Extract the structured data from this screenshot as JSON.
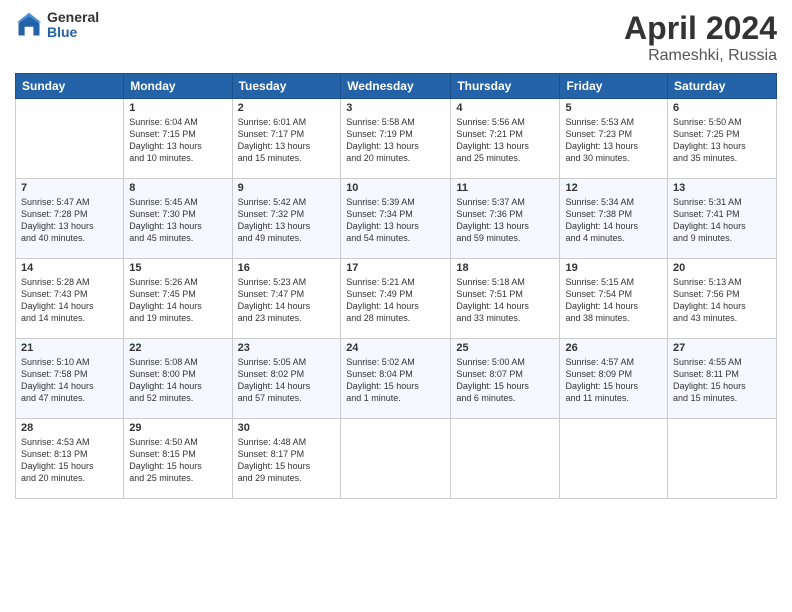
{
  "logo": {
    "general": "General",
    "blue": "Blue"
  },
  "title": {
    "month": "April 2024",
    "location": "Rameshki, Russia"
  },
  "weekdays": [
    "Sunday",
    "Monday",
    "Tuesday",
    "Wednesday",
    "Thursday",
    "Friday",
    "Saturday"
  ],
  "weeks": [
    [
      {
        "day": "",
        "info": ""
      },
      {
        "day": "1",
        "info": "Sunrise: 6:04 AM\nSunset: 7:15 PM\nDaylight: 13 hours\nand 10 minutes."
      },
      {
        "day": "2",
        "info": "Sunrise: 6:01 AM\nSunset: 7:17 PM\nDaylight: 13 hours\nand 15 minutes."
      },
      {
        "day": "3",
        "info": "Sunrise: 5:58 AM\nSunset: 7:19 PM\nDaylight: 13 hours\nand 20 minutes."
      },
      {
        "day": "4",
        "info": "Sunrise: 5:56 AM\nSunset: 7:21 PM\nDaylight: 13 hours\nand 25 minutes."
      },
      {
        "day": "5",
        "info": "Sunrise: 5:53 AM\nSunset: 7:23 PM\nDaylight: 13 hours\nand 30 minutes."
      },
      {
        "day": "6",
        "info": "Sunrise: 5:50 AM\nSunset: 7:25 PM\nDaylight: 13 hours\nand 35 minutes."
      }
    ],
    [
      {
        "day": "7",
        "info": "Sunrise: 5:47 AM\nSunset: 7:28 PM\nDaylight: 13 hours\nand 40 minutes."
      },
      {
        "day": "8",
        "info": "Sunrise: 5:45 AM\nSunset: 7:30 PM\nDaylight: 13 hours\nand 45 minutes."
      },
      {
        "day": "9",
        "info": "Sunrise: 5:42 AM\nSunset: 7:32 PM\nDaylight: 13 hours\nand 49 minutes."
      },
      {
        "day": "10",
        "info": "Sunrise: 5:39 AM\nSunset: 7:34 PM\nDaylight: 13 hours\nand 54 minutes."
      },
      {
        "day": "11",
        "info": "Sunrise: 5:37 AM\nSunset: 7:36 PM\nDaylight: 13 hours\nand 59 minutes."
      },
      {
        "day": "12",
        "info": "Sunrise: 5:34 AM\nSunset: 7:38 PM\nDaylight: 14 hours\nand 4 minutes."
      },
      {
        "day": "13",
        "info": "Sunrise: 5:31 AM\nSunset: 7:41 PM\nDaylight: 14 hours\nand 9 minutes."
      }
    ],
    [
      {
        "day": "14",
        "info": "Sunrise: 5:28 AM\nSunset: 7:43 PM\nDaylight: 14 hours\nand 14 minutes."
      },
      {
        "day": "15",
        "info": "Sunrise: 5:26 AM\nSunset: 7:45 PM\nDaylight: 14 hours\nand 19 minutes."
      },
      {
        "day": "16",
        "info": "Sunrise: 5:23 AM\nSunset: 7:47 PM\nDaylight: 14 hours\nand 23 minutes."
      },
      {
        "day": "17",
        "info": "Sunrise: 5:21 AM\nSunset: 7:49 PM\nDaylight: 14 hours\nand 28 minutes."
      },
      {
        "day": "18",
        "info": "Sunrise: 5:18 AM\nSunset: 7:51 PM\nDaylight: 14 hours\nand 33 minutes."
      },
      {
        "day": "19",
        "info": "Sunrise: 5:15 AM\nSunset: 7:54 PM\nDaylight: 14 hours\nand 38 minutes."
      },
      {
        "day": "20",
        "info": "Sunrise: 5:13 AM\nSunset: 7:56 PM\nDaylight: 14 hours\nand 43 minutes."
      }
    ],
    [
      {
        "day": "21",
        "info": "Sunrise: 5:10 AM\nSunset: 7:58 PM\nDaylight: 14 hours\nand 47 minutes."
      },
      {
        "day": "22",
        "info": "Sunrise: 5:08 AM\nSunset: 8:00 PM\nDaylight: 14 hours\nand 52 minutes."
      },
      {
        "day": "23",
        "info": "Sunrise: 5:05 AM\nSunset: 8:02 PM\nDaylight: 14 hours\nand 57 minutes."
      },
      {
        "day": "24",
        "info": "Sunrise: 5:02 AM\nSunset: 8:04 PM\nDaylight: 15 hours\nand 1 minute."
      },
      {
        "day": "25",
        "info": "Sunrise: 5:00 AM\nSunset: 8:07 PM\nDaylight: 15 hours\nand 6 minutes."
      },
      {
        "day": "26",
        "info": "Sunrise: 4:57 AM\nSunset: 8:09 PM\nDaylight: 15 hours\nand 11 minutes."
      },
      {
        "day": "27",
        "info": "Sunrise: 4:55 AM\nSunset: 8:11 PM\nDaylight: 15 hours\nand 15 minutes."
      }
    ],
    [
      {
        "day": "28",
        "info": "Sunrise: 4:53 AM\nSunset: 8:13 PM\nDaylight: 15 hours\nand 20 minutes."
      },
      {
        "day": "29",
        "info": "Sunrise: 4:50 AM\nSunset: 8:15 PM\nDaylight: 15 hours\nand 25 minutes."
      },
      {
        "day": "30",
        "info": "Sunrise: 4:48 AM\nSunset: 8:17 PM\nDaylight: 15 hours\nand 29 minutes."
      },
      {
        "day": "",
        "info": ""
      },
      {
        "day": "",
        "info": ""
      },
      {
        "day": "",
        "info": ""
      },
      {
        "day": "",
        "info": ""
      }
    ]
  ]
}
